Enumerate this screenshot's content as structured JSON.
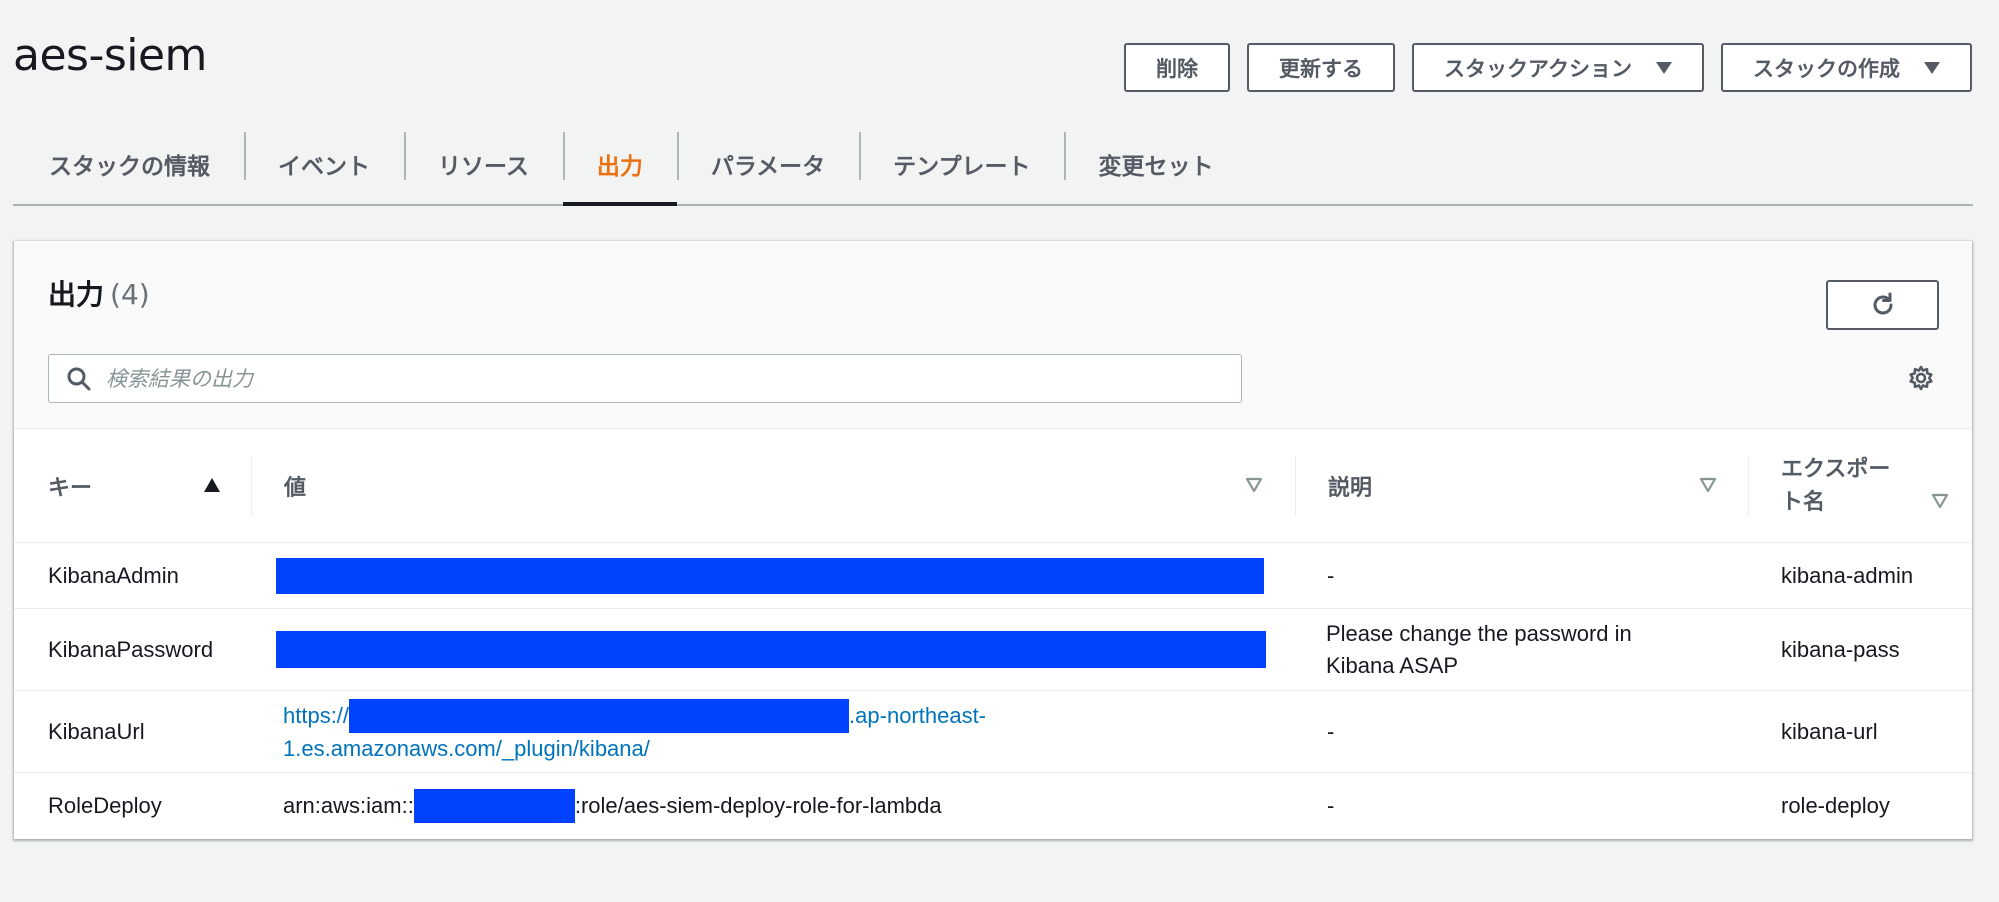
{
  "stack": {
    "title": "aes-siem"
  },
  "actions": [
    {
      "label": "削除"
    },
    {
      "label": "更新する"
    },
    {
      "label": "スタックアクション"
    },
    {
      "label": "スタックの作成"
    }
  ],
  "tabs": [
    {
      "label": "スタックの情報"
    },
    {
      "label": "イベント"
    },
    {
      "label": "リソース"
    },
    {
      "label": "出力",
      "active": true
    },
    {
      "label": "パラメータ"
    },
    {
      "label": "テンプレート"
    },
    {
      "label": "変更セット"
    }
  ],
  "outputs": {
    "title": "出力",
    "count": "(4)",
    "search_placeholder": "検索結果の出力",
    "columns": {
      "key": "キー",
      "value": "値",
      "description": "説明",
      "export_name_line1": "エクスポー",
      "export_name_line2": "ト名"
    },
    "rows": [
      {
        "key": "KibanaAdmin",
        "description": "-",
        "export_name": "kibana-admin"
      },
      {
        "key": "KibanaPassword",
        "description_line1": "Please change the password in",
        "description_line2": "Kibana ASAP",
        "export_name": "kibana-pass"
      },
      {
        "key": "KibanaUrl",
        "value_prefix": "https://",
        "value_mid": ".ap-northeast-",
        "value_line2": "1.es.amazonaws.com/_plugin/kibana/",
        "description": "-",
        "export_name": "kibana-url"
      },
      {
        "key": "RoleDeploy",
        "value_prefix": "arn:aws:iam::",
        "value_suffix": ":role/aes-siem-deploy-role-for-lambda",
        "description": "-",
        "export_name": "role-deploy"
      }
    ]
  },
  "colors": {
    "accent": "#ec7211",
    "link": "#0073bb",
    "redaction": "#0042ff"
  },
  "icons": {
    "caret": "caret-down-icon",
    "refresh": "refresh-icon",
    "search": "search-icon",
    "settings": "gear-icon",
    "sort_asc": "sort-ascending-icon",
    "sort_none": "sort-icon"
  }
}
